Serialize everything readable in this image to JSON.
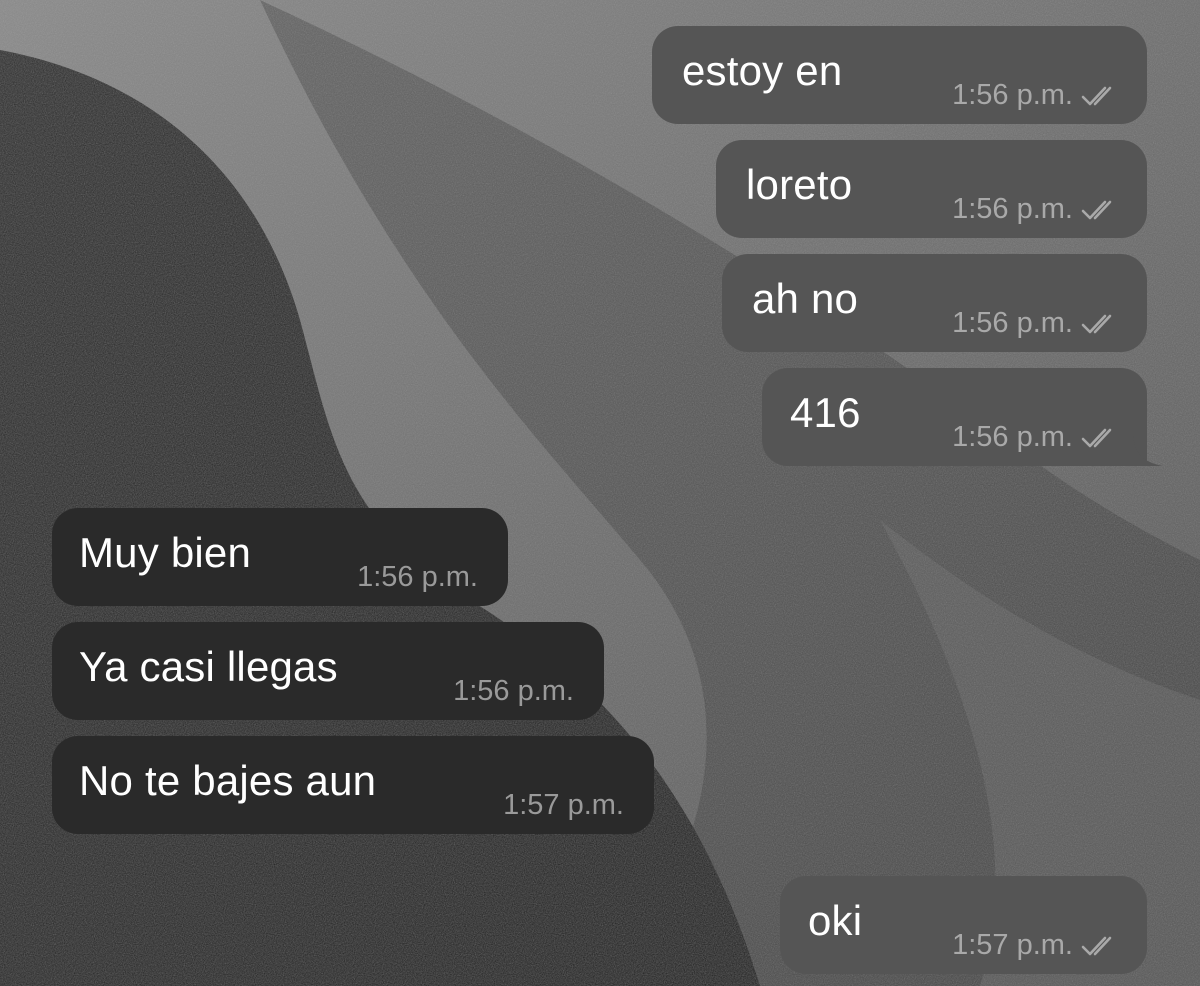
{
  "colors": {
    "outgoing_bubble": "#555555",
    "incoming_bubble": "#2a2a2a",
    "message_text": "#ffffff",
    "timestamp_text": "#a9a9a9",
    "wallpaper_light": "#8a8a8a",
    "wallpaper_dark": "#1c1c1c"
  },
  "icons": {
    "read_receipt": "double-check-icon"
  },
  "messages": [
    {
      "direction": "outgoing",
      "text": "estoy en",
      "time": "1:56 p.m.",
      "status": "read"
    },
    {
      "direction": "outgoing",
      "text": "loreto",
      "time": "1:56 p.m.",
      "status": "read"
    },
    {
      "direction": "outgoing",
      "text": "ah no",
      "time": "1:56 p.m.",
      "status": "read"
    },
    {
      "direction": "outgoing",
      "text": "416",
      "time": "1:56 p.m.",
      "status": "read"
    },
    {
      "direction": "incoming",
      "text": "Muy bien",
      "time": "1:56 p.m."
    },
    {
      "direction": "incoming",
      "text": "Ya casi llegas",
      "time": "1:56 p.m."
    },
    {
      "direction": "incoming",
      "text": "No te bajes aun",
      "time": "1:57 p.m."
    },
    {
      "direction": "outgoing",
      "text": "oki",
      "time": "1:57 p.m.",
      "status": "read"
    }
  ]
}
